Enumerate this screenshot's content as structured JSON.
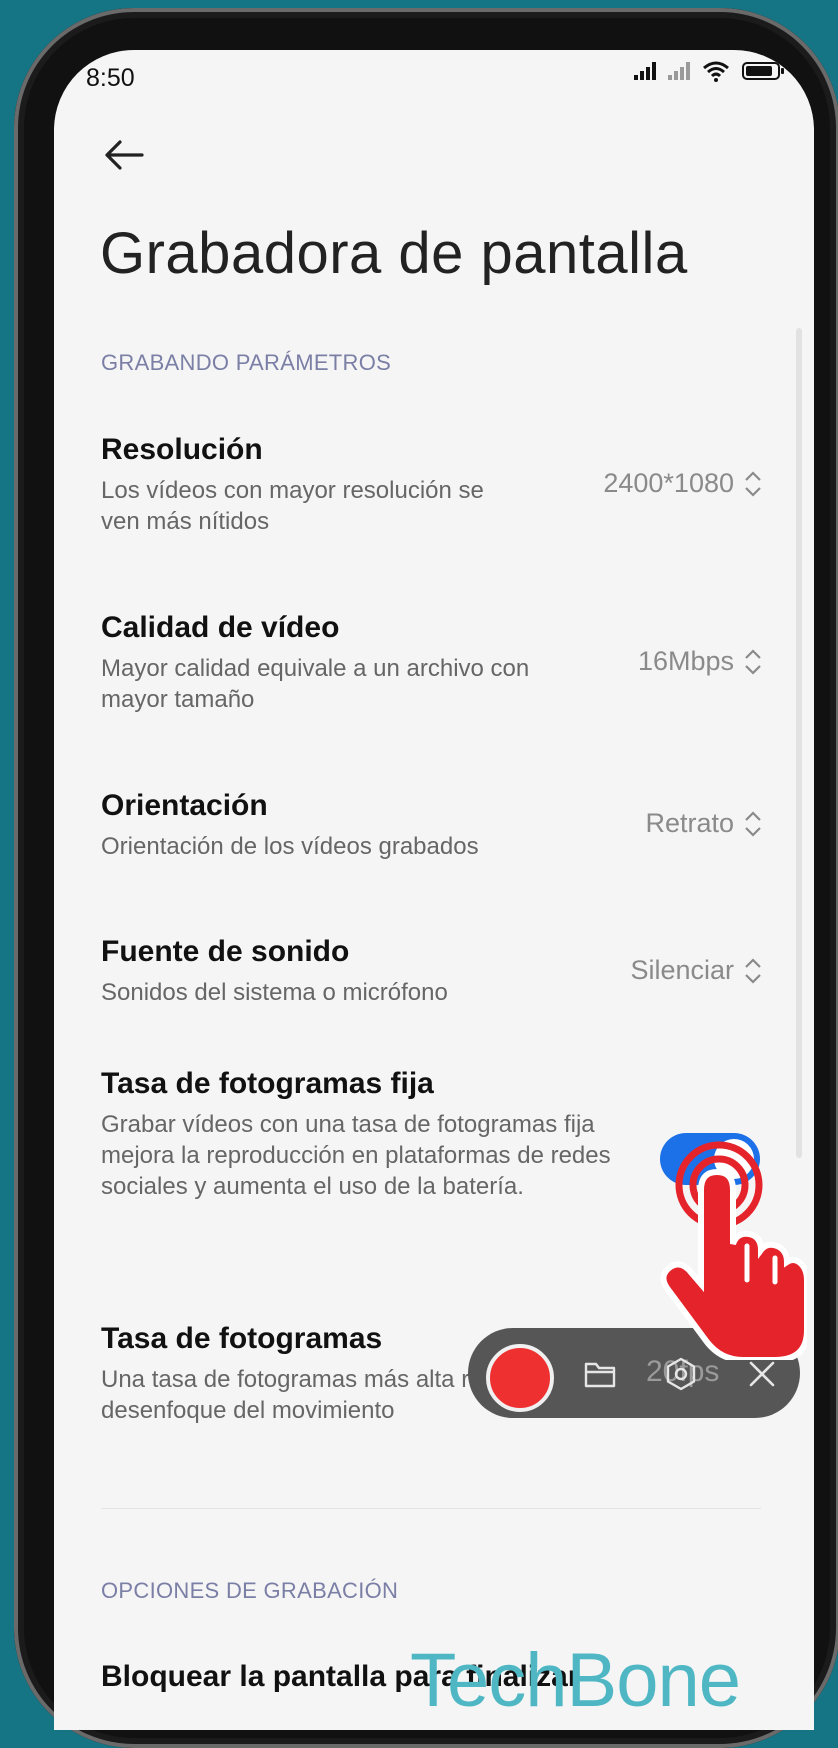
{
  "status_bar": {
    "time": "8:50"
  },
  "page": {
    "title": "Grabadora de pantalla"
  },
  "sections": {
    "recording_params_header": "GRABANDO PARÁMETROS",
    "recording_options_header": "OPCIONES DE GRABACIÓN"
  },
  "settings": [
    {
      "title": "Resolución",
      "desc": "Los vídeos con mayor resolución se ven más nítidos",
      "value": "2400*1080"
    },
    {
      "title": "Calidad de vídeo",
      "desc": "Mayor calidad equivale a un archivo con mayor tamaño",
      "value": "16Mbps"
    },
    {
      "title": "Orientación",
      "desc": "Orientación de los vídeos grabados",
      "value": "Retrato"
    },
    {
      "title": "Fuente de sonido",
      "desc": "Sonidos del sistema o micrófono",
      "value": "Silenciar"
    },
    {
      "title": "Tasa de fotogramas fija",
      "desc": "Grabar vídeos con una tasa de fotogramas fija mejora la reproducción en plataformas de redes sociales y aumenta el uso de la batería.",
      "toggle_on": true
    },
    {
      "title": "Tasa de fotogramas",
      "desc": "Una tasa de fotogramas más alta reduce el desenfoque del movimiento",
      "value": "20fps"
    }
  ],
  "last_item": {
    "title": "Bloquear la pantalla para finalizar"
  },
  "watermark": "TechBone",
  "colors": {
    "accent": "#1d71e8",
    "background": "#157584",
    "record": "#ef3030"
  },
  "icons": [
    "back-arrow-icon",
    "signal-icon",
    "wifi-icon",
    "battery-icon",
    "record-icon",
    "folder-icon",
    "settings-icon",
    "close-icon",
    "updown-chevron-icon",
    "hand-pointer-icon"
  ]
}
